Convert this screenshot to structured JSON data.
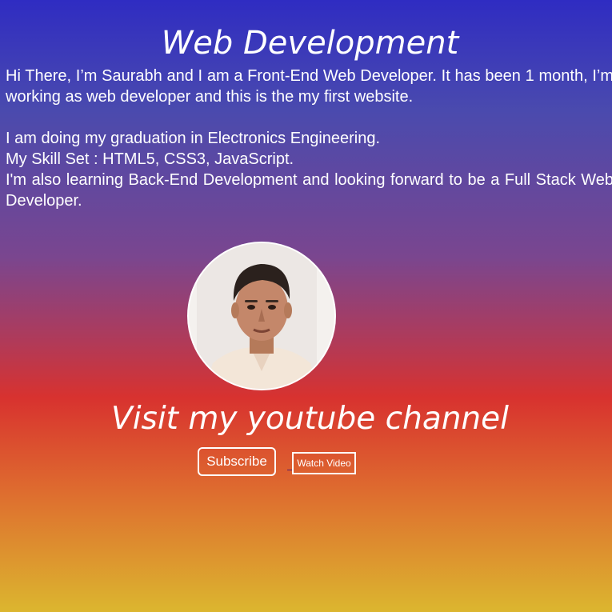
{
  "header": {
    "title": "Web Development"
  },
  "intro": {
    "paragraph1": "Hi There, I’m Saurabh and I am a Front-End Web Developer. It has been 1 month, I’m working as web developer and this is the my first website.",
    "line_education": "I am doing my graduation in Electronics Engineering.",
    "line_skills": "My Skill Set : HTML5, CSS3, JavaScript.",
    "line_learning": "I'm also learning Back-End Development and looking forward to be a Full Stack Web Developer."
  },
  "profile": {
    "avatar_alt": ""
  },
  "youtube": {
    "heading": "Visit my youtube channel",
    "subscribe_label": "Subscribe",
    "watch_label": "Watch Video"
  },
  "colors": {
    "gradient_top": "#2f2cc2",
    "gradient_middle": "#d8322f",
    "gradient_bottom": "#dcb62f",
    "text": "#ffffff"
  }
}
